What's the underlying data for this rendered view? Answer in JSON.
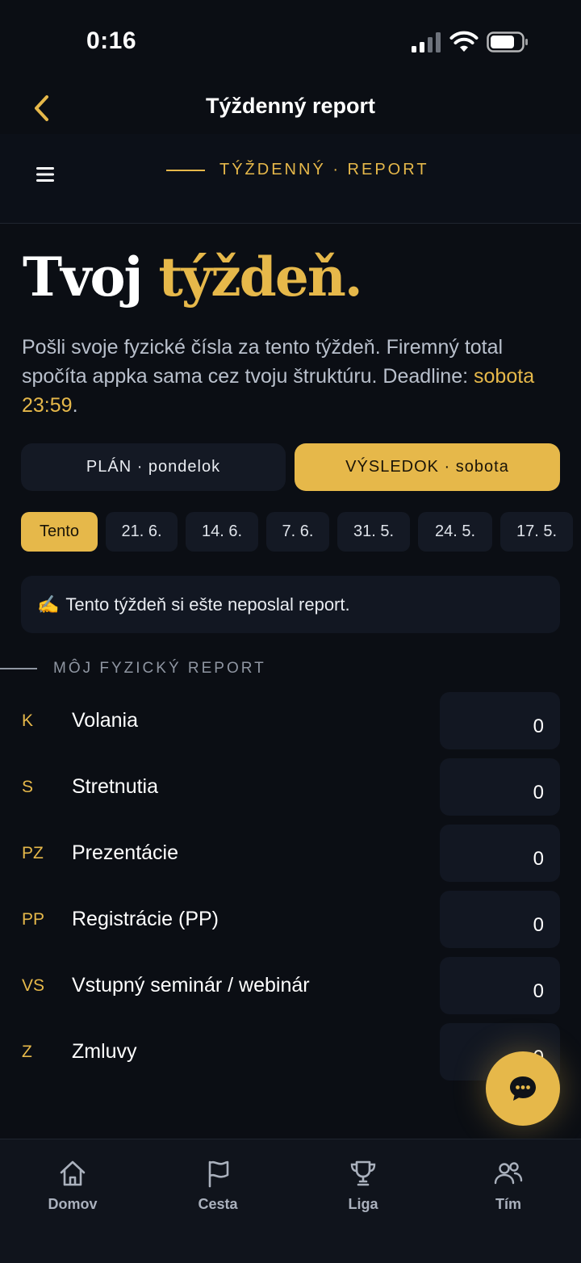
{
  "status_bar": {
    "time": "0:16"
  },
  "nav": {
    "title": "Týždenný report"
  },
  "app_bar": {
    "label": "TÝŽDENNÝ · REPORT"
  },
  "hero": {
    "title_white": "Tvoj",
    "title_gold": "týždeň.",
    "text": "Pošli svoje fyzické čísla za tento týždeň. Firemný total spočíta appka sama cez tvoju štruktúru. Deadline:",
    "deadline": "sobota 23:59",
    "deadline_suffix": "."
  },
  "toggle": {
    "plan_label": "PLÁN · pondelok",
    "result_label": "VÝSLEDOK · sobota",
    "selected": "result"
  },
  "weeks": {
    "items": [
      {
        "label": "Tento",
        "active": true
      },
      {
        "label": "21. 6.",
        "active": false
      },
      {
        "label": "14. 6.",
        "active": false
      },
      {
        "label": "7. 6.",
        "active": false
      },
      {
        "label": "31. 5.",
        "active": false
      },
      {
        "label": "24. 5.",
        "active": false
      },
      {
        "label": "17. 5.",
        "active": false
      }
    ]
  },
  "notice": {
    "emoji": "✍",
    "text": "Tento týždeň si ešte neposlal report."
  },
  "section": {
    "title": "MÔJ FYZICKÝ REPORT"
  },
  "metrics": [
    {
      "code": "K",
      "name": "Volania",
      "value": "0"
    },
    {
      "code": "S",
      "name": "Stretnutia",
      "value": "0"
    },
    {
      "code": "PZ",
      "name": "Prezentácie",
      "value": "0"
    },
    {
      "code": "PP",
      "name": "Registrácie (PP)",
      "value": "0"
    },
    {
      "code": "VS",
      "name": "Vstupný seminár / webinár",
      "value": "0"
    },
    {
      "code": "Z",
      "name": "Zmluvy",
      "value": "0"
    }
  ],
  "tabs": [
    {
      "label": "Domov",
      "icon": "home-icon"
    },
    {
      "label": "Cesta",
      "icon": "flag-icon"
    },
    {
      "label": "Liga",
      "icon": "trophy-icon"
    },
    {
      "label": "Tím",
      "icon": "team-icon"
    }
  ],
  "colors": {
    "accent": "#e6b84a",
    "background": "#0b0e14",
    "surface": "#141924"
  }
}
